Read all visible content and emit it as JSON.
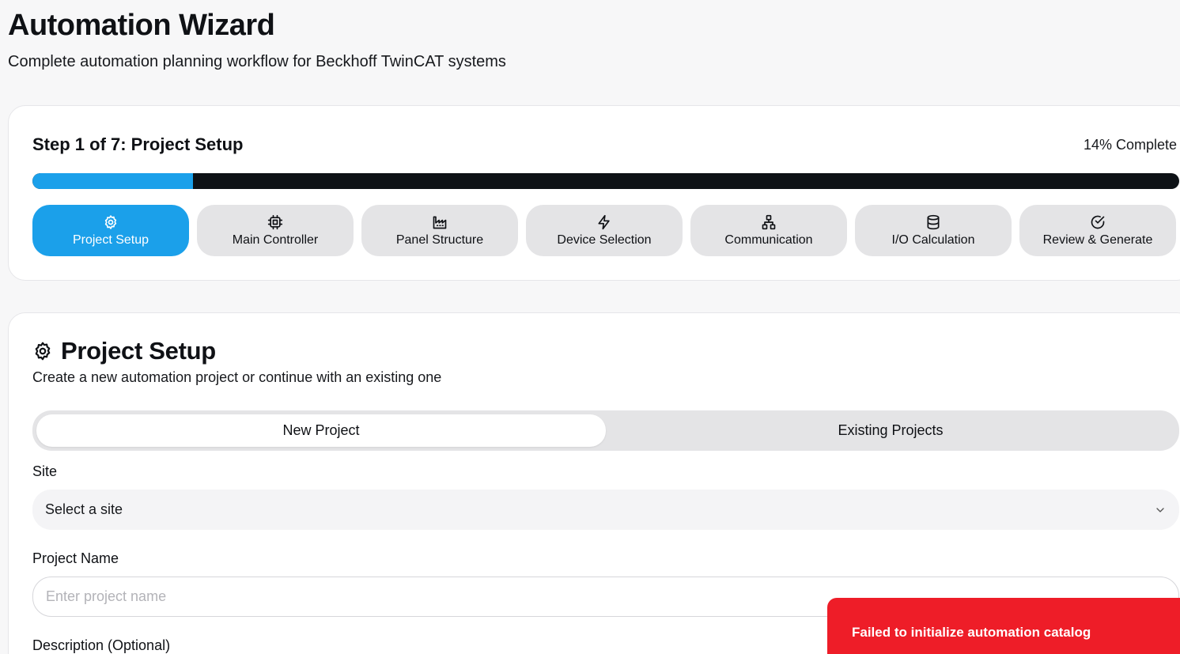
{
  "page": {
    "title": "Automation Wizard",
    "subtitle": "Complete automation planning workflow for Beckhoff TwinCAT systems"
  },
  "progress": {
    "step_label": "Step 1 of 7: Project Setup",
    "complete_label": "14% Complete",
    "percent": 14,
    "accent_color": "#1ba0ea",
    "track_color": "#0e1216"
  },
  "steps": [
    {
      "label": "Project Setup",
      "icon": "gear-icon",
      "active": true
    },
    {
      "label": "Main Controller",
      "icon": "cpu-icon",
      "active": false
    },
    {
      "label": "Panel Structure",
      "icon": "factory-icon",
      "active": false
    },
    {
      "label": "Device Selection",
      "icon": "lightning-icon",
      "active": false
    },
    {
      "label": "Communication",
      "icon": "network-icon",
      "active": false
    },
    {
      "label": "I/O Calculation",
      "icon": "database-icon",
      "active": false
    },
    {
      "label": "Review & Generate",
      "icon": "check-circle-icon",
      "active": false
    }
  ],
  "setup": {
    "title": "Project Setup",
    "description": "Create a new automation project or continue with an existing one",
    "tabs": [
      {
        "label": "New Project",
        "active": true
      },
      {
        "label": "Existing Projects",
        "active": false
      }
    ],
    "site_label": "Site",
    "site_value": "Select a site",
    "project_name_label": "Project Name",
    "project_name_placeholder": "Enter project name",
    "description_label": "Description (Optional)"
  },
  "toast": {
    "message": "Failed to initialize automation catalog",
    "color": "#ee1d28"
  }
}
